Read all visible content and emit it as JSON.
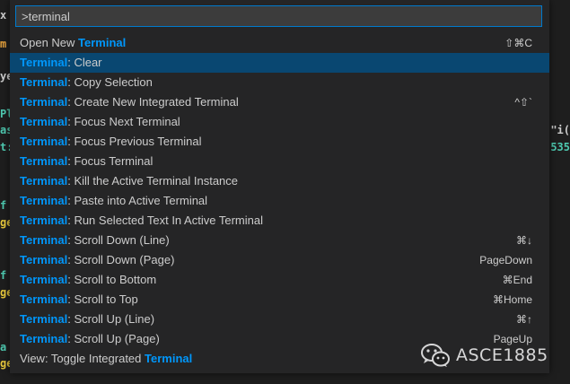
{
  "palette": {
    "input_value": ">terminal",
    "highlight_color": "#0097fb",
    "selected_color": "#094771",
    "items": [
      {
        "prefix": "Open New ",
        "match": "Terminal",
        "suffix": "",
        "keybinding": "⇧⌘C"
      },
      {
        "prefix": "",
        "match": "Terminal",
        "suffix": ": Clear",
        "keybinding": ""
      },
      {
        "prefix": "",
        "match": "Terminal",
        "suffix": ": Copy Selection",
        "keybinding": ""
      },
      {
        "prefix": "",
        "match": "Terminal",
        "suffix": ": Create New Integrated Terminal",
        "keybinding": "^⇧`"
      },
      {
        "prefix": "",
        "match": "Terminal",
        "suffix": ": Focus Next Terminal",
        "keybinding": ""
      },
      {
        "prefix": "",
        "match": "Terminal",
        "suffix": ": Focus Previous Terminal",
        "keybinding": ""
      },
      {
        "prefix": "",
        "match": "Terminal",
        "suffix": ": Focus Terminal",
        "keybinding": ""
      },
      {
        "prefix": "",
        "match": "Terminal",
        "suffix": ": Kill the Active Terminal Instance",
        "keybinding": ""
      },
      {
        "prefix": "",
        "match": "Terminal",
        "suffix": ": Paste into Active Terminal",
        "keybinding": ""
      },
      {
        "prefix": "",
        "match": "Terminal",
        "suffix": ": Run Selected Text In Active Terminal",
        "keybinding": ""
      },
      {
        "prefix": "",
        "match": "Terminal",
        "suffix": ": Scroll Down (Line)",
        "keybinding": "⌘↓"
      },
      {
        "prefix": "",
        "match": "Terminal",
        "suffix": ": Scroll Down (Page)",
        "keybinding": "PageDown"
      },
      {
        "prefix": "",
        "match": "Terminal",
        "suffix": ": Scroll to Bottom",
        "keybinding": "⌘End"
      },
      {
        "prefix": "",
        "match": "Terminal",
        "suffix": ": Scroll to Top",
        "keybinding": "⌘Home"
      },
      {
        "prefix": "",
        "match": "Terminal",
        "suffix": ": Scroll Up (Line)",
        "keybinding": "⌘↑"
      },
      {
        "prefix": "",
        "match": "Terminal",
        "suffix": ": Scroll Up (Page)",
        "keybinding": "PageUp"
      },
      {
        "prefix": "View: Toggle Integrated ",
        "match": "Terminal",
        "suffix": "",
        "keybinding": ""
      }
    ]
  },
  "background_editor": {
    "left": [
      {
        "text": "x",
        "color": "#cccccc"
      },
      {
        "text": "m",
        "color": "#e8a33d"
      },
      {
        "text": "ye",
        "color": "#cccccc"
      },
      {
        "text": "Pl",
        "color": "#4ec9b0"
      },
      {
        "text": "as",
        "color": "#4ec9b0"
      },
      {
        "text": "t:@",
        "color": "#4ec9b0"
      },
      {
        "text": "f",
        "color": "#4ec9b0"
      },
      {
        "text": "ge",
        "color": "#e8c93d"
      },
      {
        "text": "f",
        "color": "#4ec9b0"
      },
      {
        "text": "ge",
        "color": "#e8c93d"
      },
      {
        "text": "a",
        "color": "#4ec9b0"
      },
      {
        "text": "ge",
        "color": "#e8c93d"
      }
    ],
    "right": [
      {
        "text": ",\"i(",
        "color": "#cccccc"
      },
      {
        "text": "535",
        "color": "#4ec9b0"
      }
    ]
  },
  "watermark": {
    "text": "ASCE1885",
    "icon": "wechat-icon"
  }
}
